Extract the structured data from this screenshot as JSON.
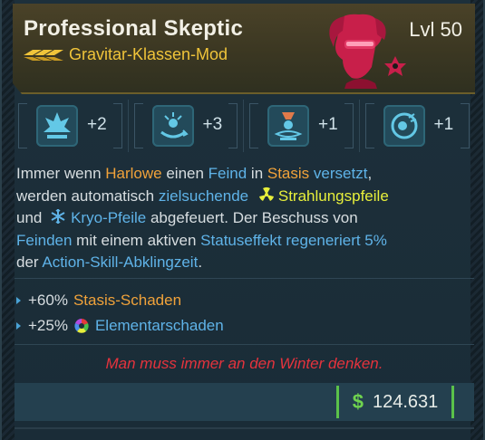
{
  "header": {
    "title": "Professional Skeptic",
    "level": "Lvl 50",
    "subtitle": "Gravitar-Klassen-Mod",
    "rarity_color": "#f0c43a",
    "portrait_icon": "harlowe-portrait-icon"
  },
  "skills": [
    {
      "icon": "skill-tree-icon-1",
      "value": "+2"
    },
    {
      "icon": "skill-tree-icon-2",
      "value": "+3"
    },
    {
      "icon": "skill-tree-icon-3",
      "value": "+1"
    },
    {
      "icon": "skill-tree-icon-4",
      "value": "+1"
    }
  ],
  "description": {
    "p1": "Immer wenn ",
    "harlowe": "Harlowe",
    "p2": " einen ",
    "feind": "Feind",
    "p3": " in ",
    "stasis": "Stasis",
    "p4": " ",
    "versetzt": "versetzt",
    "p5": ",",
    "p6": "werden automatisch ",
    "zielsuchende": "zielsuchende",
    "p7": " ",
    "strahlungspfeile": "Strahlungspfeile",
    "p8": "und ",
    "kryo": "Kryo-Pfeile",
    "p9": " abgefeuert. Der Beschuss von",
    "feinden": "Feinden",
    "p10": " mit einem aktiven ",
    "statuseffekt": "Statuseffekt",
    "p11": " ",
    "regeneriert": "regeneriert 5%",
    "p12": "der ",
    "abklingzeit": "Action-Skill-Abklingzeit",
    "p13": "."
  },
  "bullets": [
    {
      "pct": "+60%",
      "label": "Stasis-Schaden"
    },
    {
      "pct": "+25%",
      "label": "Elementarschaden"
    }
  ],
  "flavor": "Man muss immer an den Winter denken.",
  "price": {
    "symbol": "$",
    "value": "124.631"
  },
  "colors": {
    "accent_orange": "#f0a23a",
    "accent_blue": "#5fb3e8",
    "accent_yellow": "#e7ef3b",
    "flavor_red": "#e5333d",
    "money_green": "#5bc24a"
  }
}
